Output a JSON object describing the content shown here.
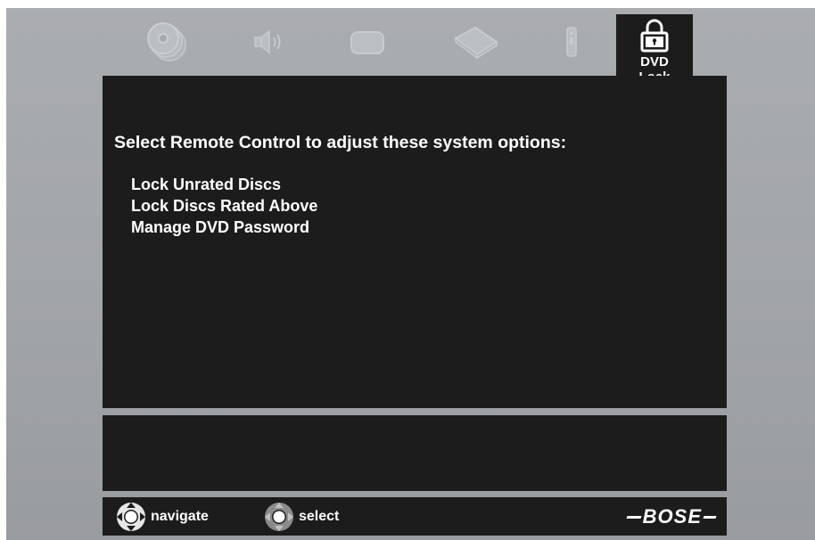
{
  "tabs": [
    {
      "icon": "disc-icon",
      "active": false
    },
    {
      "icon": "speaker-icon",
      "active": false
    },
    {
      "icon": "tv-icon",
      "active": false
    },
    {
      "icon": "console-icon",
      "active": false
    },
    {
      "icon": "remote-icon",
      "active": false
    },
    {
      "icon": "lock-icon",
      "active": true,
      "label": "DVD\nLock"
    }
  ],
  "main": {
    "heading": "Select Remote Control to adjust these system options:",
    "options": [
      "Lock Unrated Discs",
      "Lock Discs Rated Above",
      "Manage DVD Password"
    ]
  },
  "footer": {
    "navigate_label": "navigate",
    "select_label": "select",
    "brand": "BOSE"
  },
  "colors": {
    "panel": "#1c1c1c",
    "background": "#a5a8ab",
    "text": "#ffffff",
    "inactive_icon": "#b9bcbf"
  }
}
